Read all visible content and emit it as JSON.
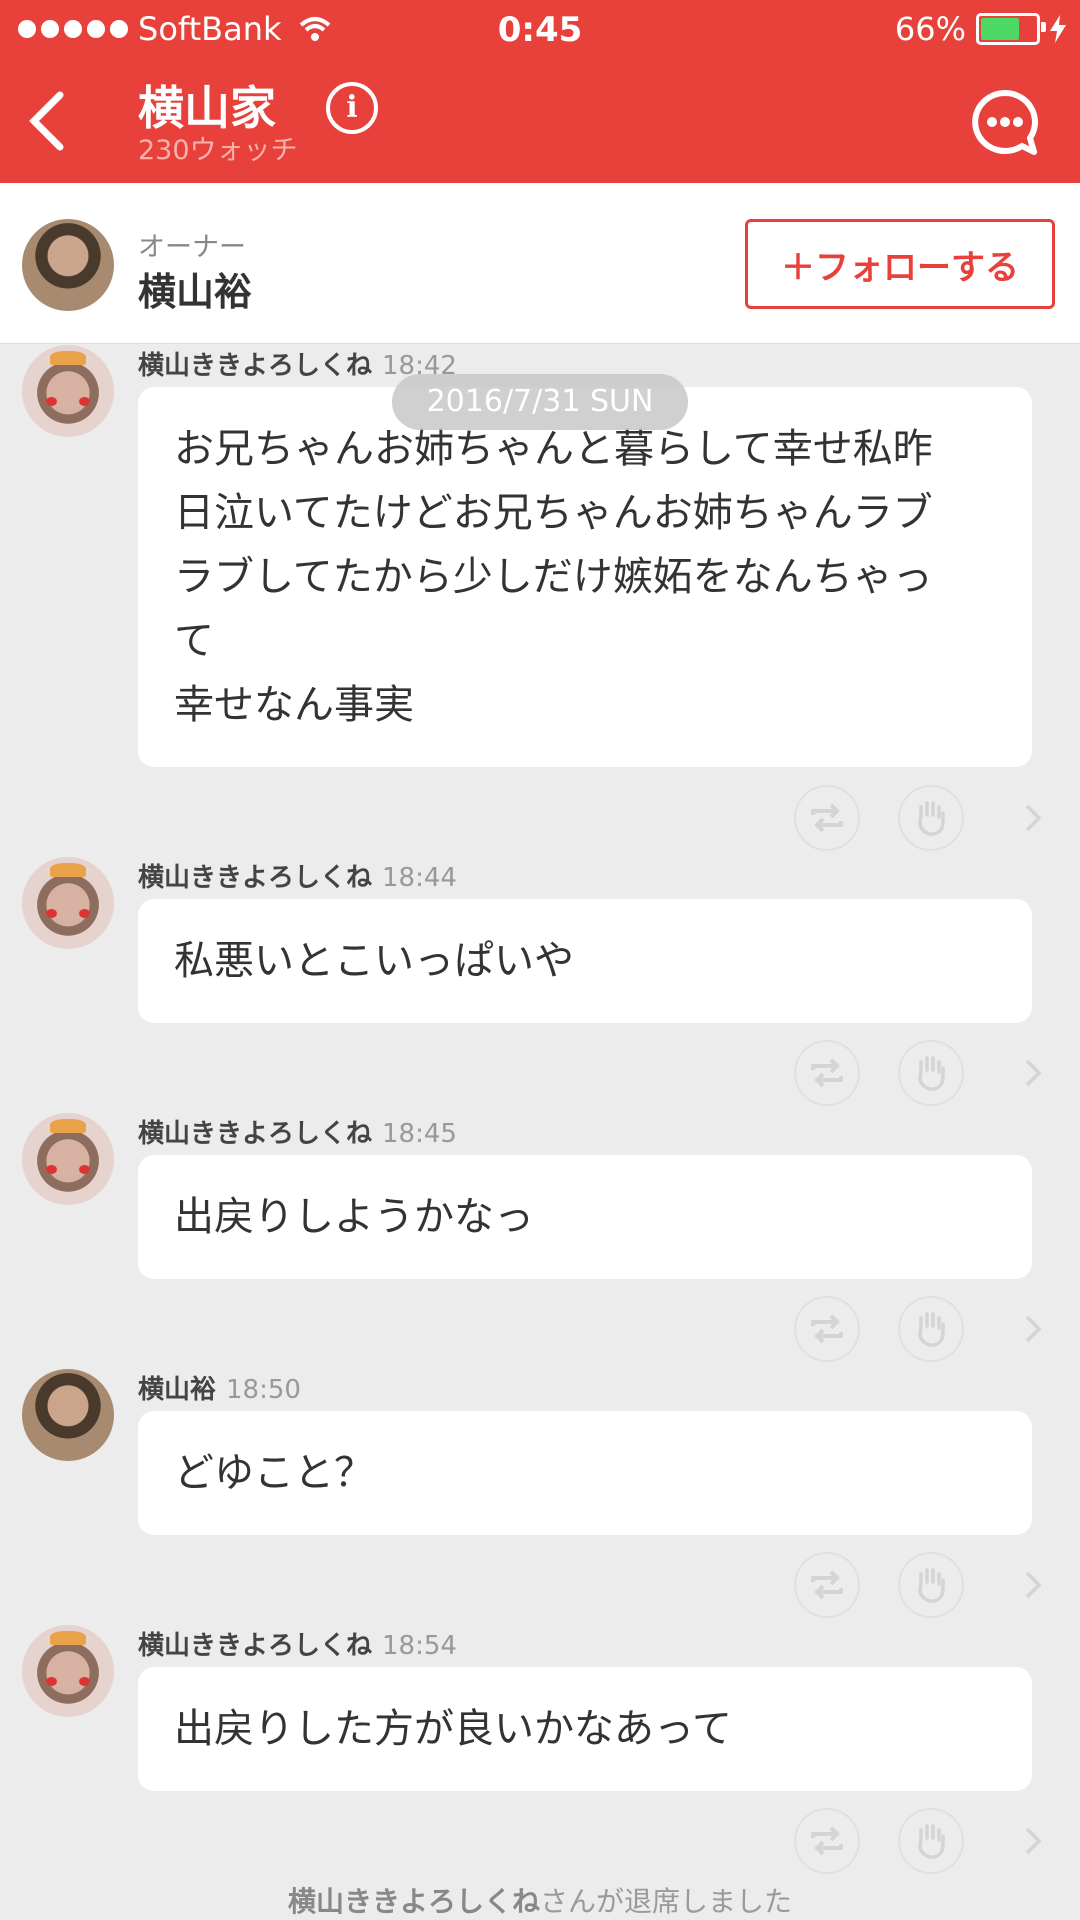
{
  "status": {
    "carrier": "SoftBank",
    "time": "0:45",
    "battery": "66%",
    "battery_level": 0.66
  },
  "header": {
    "title": "横山家",
    "watch_count": "230ウォッチ",
    "back_icon": "chevron-left-icon",
    "info_icon": "info-icon",
    "chat_icon": "chat-bubble-icon"
  },
  "owner": {
    "role": "オーナー",
    "name": "横山裕",
    "follow_label": "＋フォローする"
  },
  "date_divider": "2016/7/31 SUN",
  "messages": [
    {
      "sender": "横山ききよろしくね",
      "time": "18:42",
      "lines": [
        "お兄ちゃんお姉ちゃんと暮らして幸せ私昨",
        "日泣いてたけどお兄ちゃんお姉ちゃんラブ",
        "ラブしてたから少しだけ嫉妬をなんちゃっ",
        "て",
        "幸せなん事実"
      ]
    },
    {
      "sender": "横山ききよろしくね",
      "time": "18:44",
      "lines": [
        "私悪いとこいっぱいや"
      ]
    },
    {
      "sender": "横山ききよろしくね",
      "time": "18:45",
      "lines": [
        "出戻りしようかなっ"
      ]
    },
    {
      "sender": "横山裕",
      "time": "18:50",
      "lines": [
        "どゆこと？"
      ]
    },
    {
      "sender": "横山ききよろしくね",
      "time": "18:54",
      "lines": [
        "出戻りした方が良いかなあって"
      ]
    }
  ],
  "footer": {
    "name": "横山ききよろしくね",
    "text": "さんが退席しました"
  },
  "colors": {
    "accent": "#e8403a",
    "background": "#ececec",
    "battery_fill": "#4cd964"
  }
}
